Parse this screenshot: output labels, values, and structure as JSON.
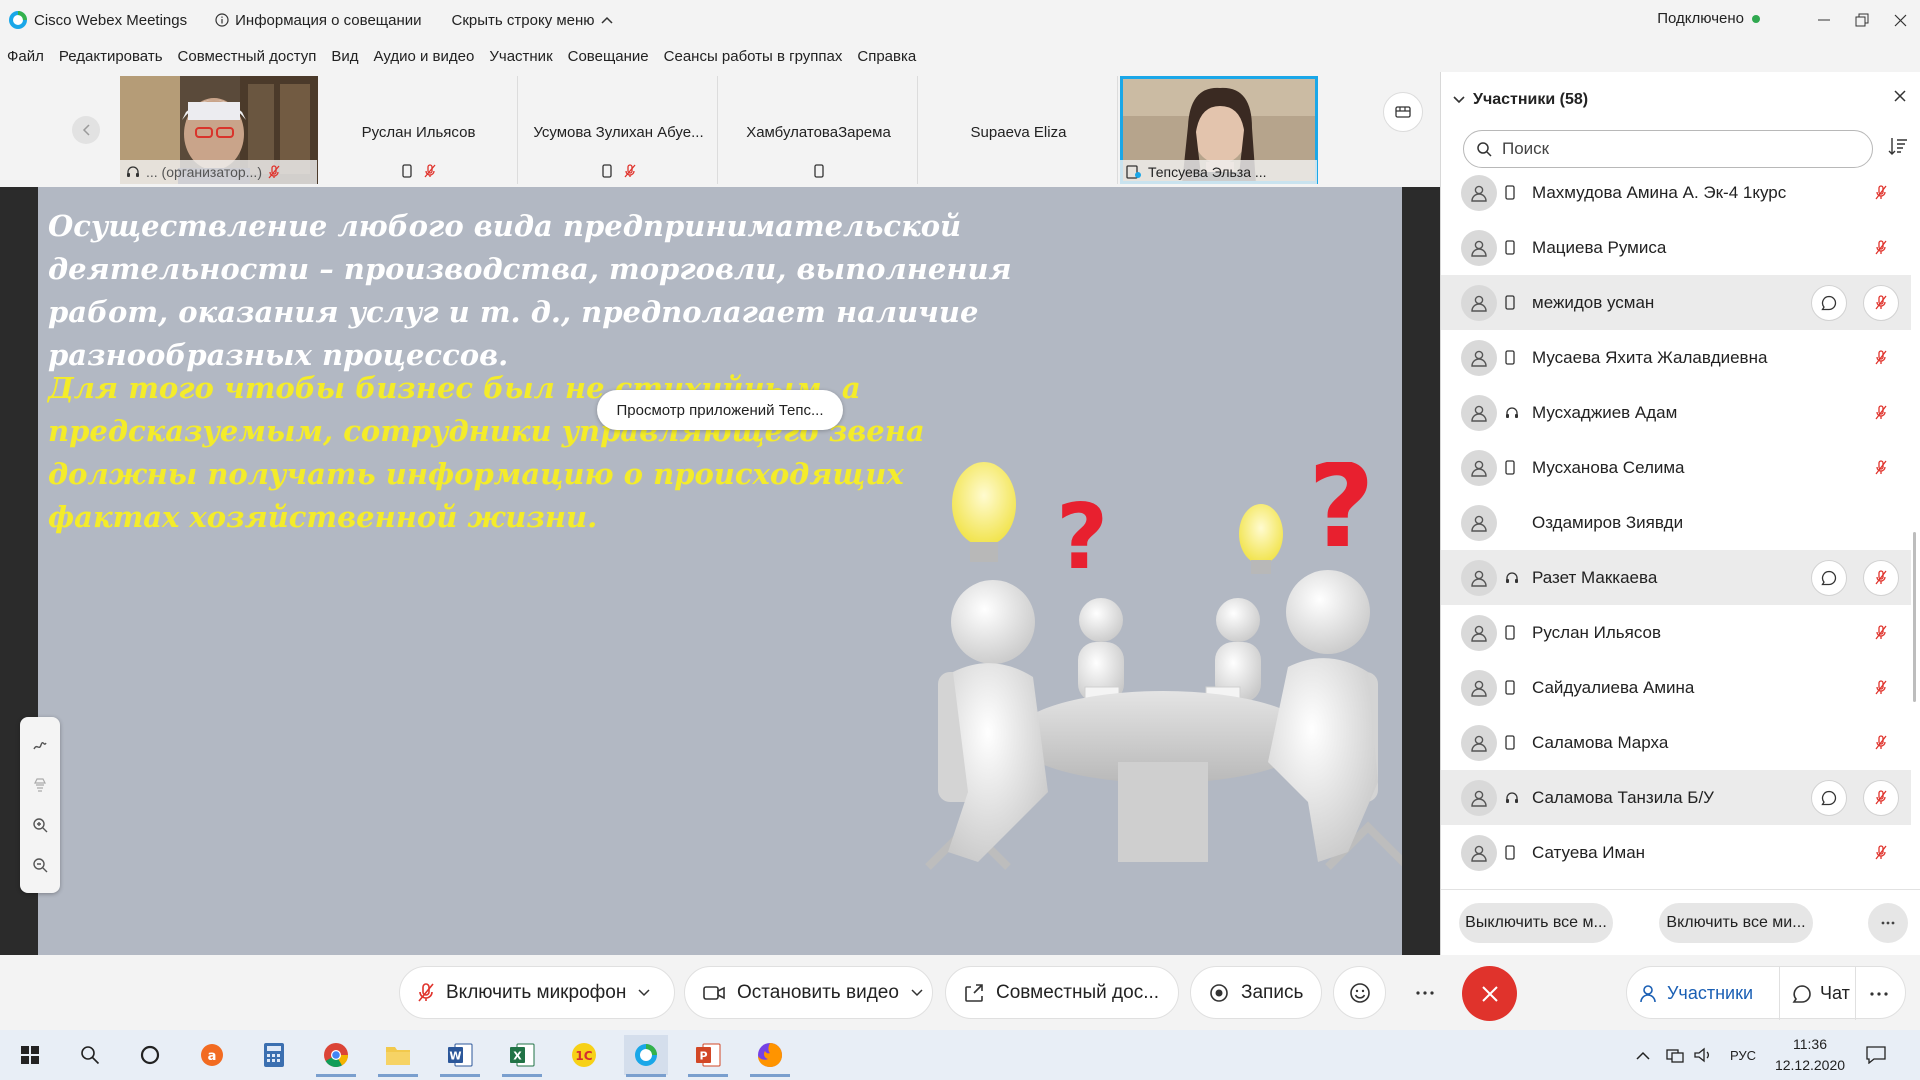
{
  "window": {
    "app_name": "Cisco Webex Meetings",
    "meeting_info_label": "Информация о совещании",
    "hide_menu_label": "Скрыть строку меню",
    "connection_status": "Подключено",
    "connection_color": "#2fa84f"
  },
  "menu": [
    "Файл",
    "Редактировать",
    "Совместный доступ",
    "Вид",
    "Аудио и видео",
    "Участник",
    "Совещание",
    "Сеансы работы в группах",
    "Справка"
  ],
  "strip": {
    "tiles": [
      {
        "name": "",
        "caption": "... (организатор...)",
        "has_video": true,
        "active": false
      },
      {
        "name": "Руслан Ильясов",
        "has_video": false,
        "active": false
      },
      {
        "name": "Усумова Зулихан Абуе...",
        "has_video": false,
        "active": false
      },
      {
        "name": "ХамбулатоваЗарема",
        "has_video": false,
        "active": false
      },
      {
        "name": "Supaeva Eliza",
        "has_video": false,
        "active": false
      },
      {
        "name": "",
        "caption": "Тепсуева Эльза ...",
        "has_video": true,
        "active": true
      }
    ]
  },
  "share": {
    "app_preview_label": "Просмотр приложений Тепс...",
    "paragraph_white": "Осуществление любого вида предпринимательской деятельности – производства, торговли, выполнения работ, оказания услуг и т. д., предполагает наличие разнообразных процессов.",
    "paragraph_yellow": "Для того чтобы бизнес был не стихийным, а предсказуемым, сотрудники управляющего звена должны получать информацию о происходящих фактах хозяйственной жизни.",
    "white_color": "#ffffff",
    "yellow_color": "#f4ec2a",
    "slide_bg": "#b2b8c3"
  },
  "participants_panel": {
    "title": "Участники (58)",
    "search_placeholder": "Поиск",
    "rows": [
      {
        "name": "Махмудова Амина А. Эк-4 1курс",
        "device": "phone-icon",
        "muted": true,
        "highlight": false,
        "chat": false
      },
      {
        "name": "Мациева Румиса",
        "device": "phone-icon",
        "muted": true,
        "highlight": false,
        "chat": false
      },
      {
        "name": "межидов усман",
        "device": "phone-icon",
        "muted": true,
        "highlight": true,
        "chat": true
      },
      {
        "name": "Мусаева Яхита Жалавдиевна",
        "device": "phone-icon",
        "muted": true,
        "highlight": false,
        "chat": false
      },
      {
        "name": "Мусхаджиев Адам",
        "device": "headset-icon",
        "muted": true,
        "highlight": false,
        "chat": false
      },
      {
        "name": "Мусханова Селима",
        "device": "phone-icon",
        "muted": true,
        "highlight": false,
        "chat": false
      },
      {
        "name": "Оздамиров Зиявди",
        "device": "",
        "muted": false,
        "highlight": false,
        "chat": false
      },
      {
        "name": "Разет Маккаева",
        "device": "headset-icon",
        "muted": true,
        "highlight": true,
        "chat": true
      },
      {
        "name": "Руслан Ильясов",
        "device": "phone-icon",
        "muted": true,
        "highlight": false,
        "chat": false
      },
      {
        "name": "Сайдуалиева Амина",
        "device": "phone-icon",
        "muted": true,
        "highlight": false,
        "chat": false
      },
      {
        "name": "Саламова Марха",
        "device": "phone-icon",
        "muted": true,
        "highlight": false,
        "chat": false
      },
      {
        "name": "Саламова Танзила Б/У",
        "device": "headset-icon",
        "muted": true,
        "highlight": true,
        "chat": true
      },
      {
        "name": "Сатуева Иман",
        "device": "phone-icon",
        "muted": true,
        "highlight": false,
        "chat": false
      }
    ],
    "mute_all_label": "Выключить все м...",
    "unmute_all_label": "Включить все ми..."
  },
  "controls": {
    "unmute_label": "Включить микрофон",
    "stop_video_label": "Остановить видео",
    "share_label": "Совместный дос...",
    "record_label": "Запись",
    "participants_label": "Участники",
    "chat_label": "Чат",
    "accent": "#1a5fb4",
    "end_color": "#e0332c",
    "mute_color": "#e0332c"
  },
  "taskbar": {
    "language": "РУС",
    "time": "11:36",
    "date": "12.12.2020"
  }
}
